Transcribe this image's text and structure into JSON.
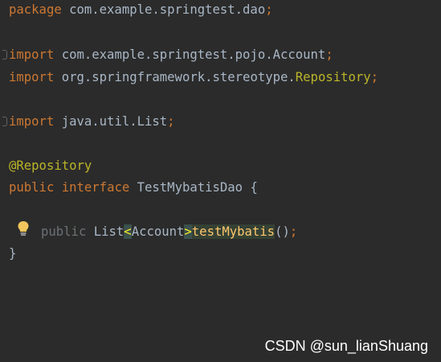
{
  "code": {
    "line1": {
      "keyword": "package",
      "text": " com.example.springtest.dao",
      "semi": ";"
    },
    "line3": {
      "keyword": "import",
      "text": " com.example.springtest.pojo.Account",
      "semi": ";"
    },
    "line4": {
      "keyword": "import",
      "text": " org.springframework.stereotype.",
      "highlight": "Repository",
      "semi": ";"
    },
    "line6": {
      "keyword": "import",
      "text": " java.util.List",
      "semi": ";"
    },
    "line8": {
      "annotation": "@Repository"
    },
    "line9": {
      "kw1": "public",
      "kw2": "interface",
      "text": " TestMybatisDao {"
    },
    "line11": {
      "kw1": "public",
      "type": "List",
      "lt": "<",
      "generic": "Account",
      "gt": ">",
      "method": "testMybatis",
      "parens": "()",
      "semi": ";"
    },
    "line12": {
      "text": "}"
    }
  },
  "icons": {
    "intention": "lightbulb-icon"
  },
  "watermark": "CSDN @sun_lianShuang"
}
